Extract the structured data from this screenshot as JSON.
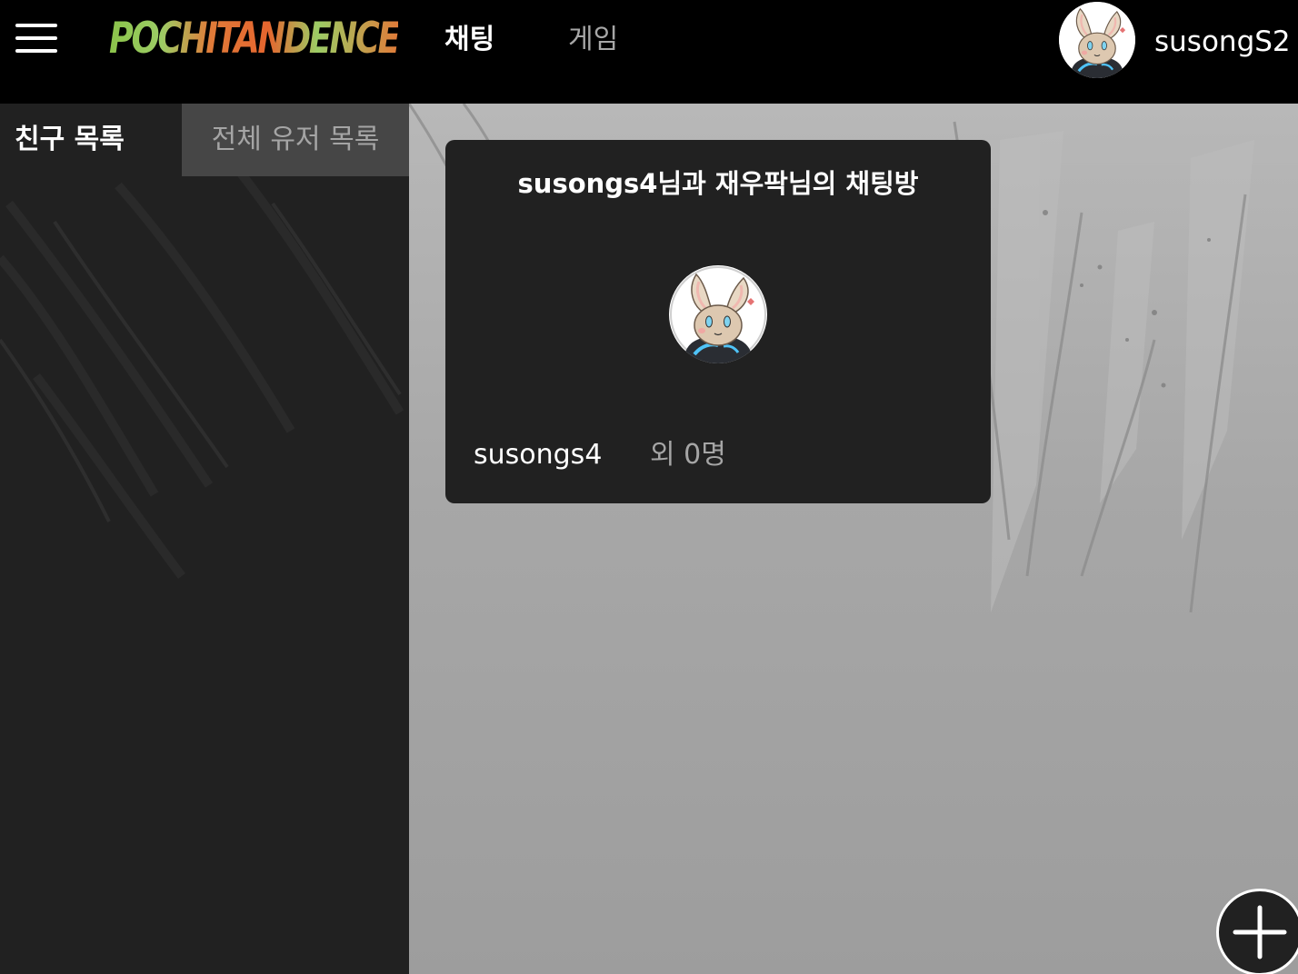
{
  "header": {
    "logo_text": "POCHITANDENCE",
    "tabs": [
      {
        "label": "채팅",
        "active": true
      },
      {
        "label": "게임",
        "active": false
      }
    ],
    "username": "susongS2"
  },
  "sidebar": {
    "tabs": [
      {
        "label": "친구 목록",
        "active": true
      },
      {
        "label": "전체 유저 목록",
        "active": false
      }
    ]
  },
  "chat_rooms": [
    {
      "title": "susongs4님과 재우팍님의 채팅방",
      "owner": "susongs4",
      "others": "외 0명"
    }
  ],
  "icons": {
    "menu": "hamburger-menu-icon",
    "avatar": "rabbit-avatar-icon",
    "add": "plus-icon"
  },
  "colors": {
    "header_bg": "#000000",
    "sidebar_bg": "#212121",
    "card_bg": "#212121",
    "inactive_tab_bg": "#464646",
    "inactive_text": "#a5a5a5",
    "logo_green": "#8bc34a",
    "logo_orange": "#e5652e"
  }
}
